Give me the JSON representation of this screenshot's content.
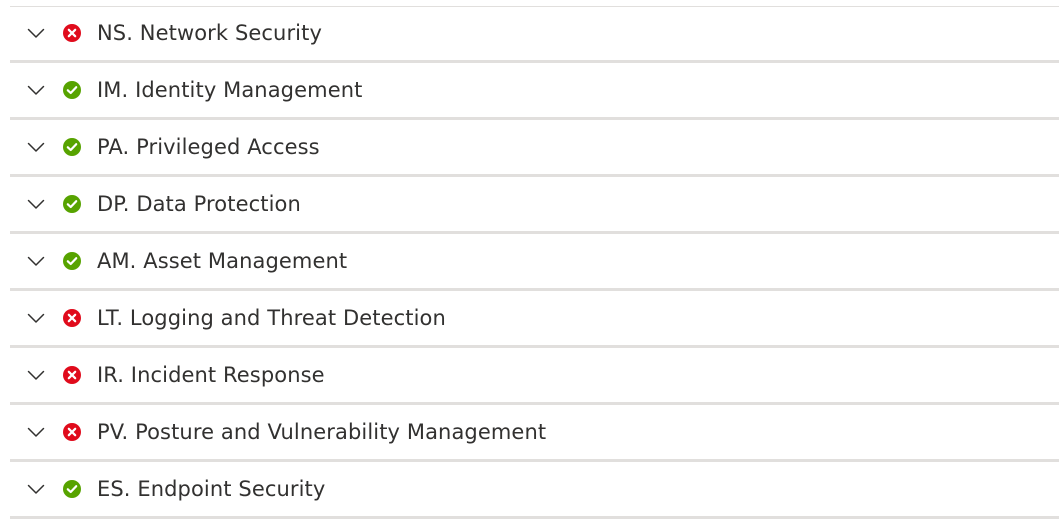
{
  "sections": [
    {
      "label": "NS. Network Security",
      "status": "failed"
    },
    {
      "label": "IM. Identity Management",
      "status": "passed"
    },
    {
      "label": "PA. Privileged Access",
      "status": "passed"
    },
    {
      "label": "DP. Data Protection",
      "status": "passed"
    },
    {
      "label": "AM. Asset Management",
      "status": "passed"
    },
    {
      "label": "LT. Logging and Threat Detection",
      "status": "failed"
    },
    {
      "label": "IR. Incident Response",
      "status": "failed"
    },
    {
      "label": "PV. Posture and Vulnerability Management",
      "status": "failed"
    },
    {
      "label": "ES. Endpoint Security",
      "status": "passed"
    }
  ],
  "icons": {
    "expand": "chevron-down-icon",
    "passed": "check-circle-icon",
    "failed": "error-circle-icon"
  },
  "colors": {
    "passed": "#57a300",
    "failed": "#e00b1c",
    "text": "#323130",
    "divider": "#e1dfdd"
  }
}
